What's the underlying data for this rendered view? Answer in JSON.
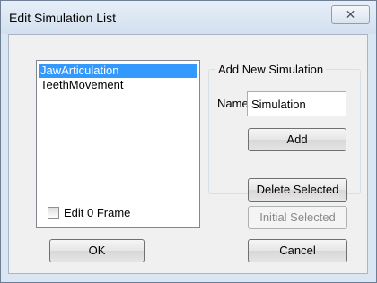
{
  "window": {
    "title": "Edit Simulation List",
    "close_glyph": "✕"
  },
  "simulation_list": {
    "items": [
      {
        "label": "JawArticulation",
        "selected": true
      },
      {
        "label": "TeethMovement",
        "selected": false
      }
    ]
  },
  "add_group": {
    "label": "Add New Simulation",
    "name_label": "Name",
    "name_value": "Simulation",
    "add_button": "Add"
  },
  "buttons": {
    "delete_selected": "Delete Selected",
    "initial_selected": "Initial Selected",
    "ok": "OK",
    "cancel": "Cancel"
  },
  "edit_frame_checkbox": {
    "label": "Edit 0 Frame",
    "checked": false
  },
  "colors": {
    "selection": "#3399ff",
    "dialog_bg": "#f0f0f0",
    "frame": "#dbe6f3"
  }
}
